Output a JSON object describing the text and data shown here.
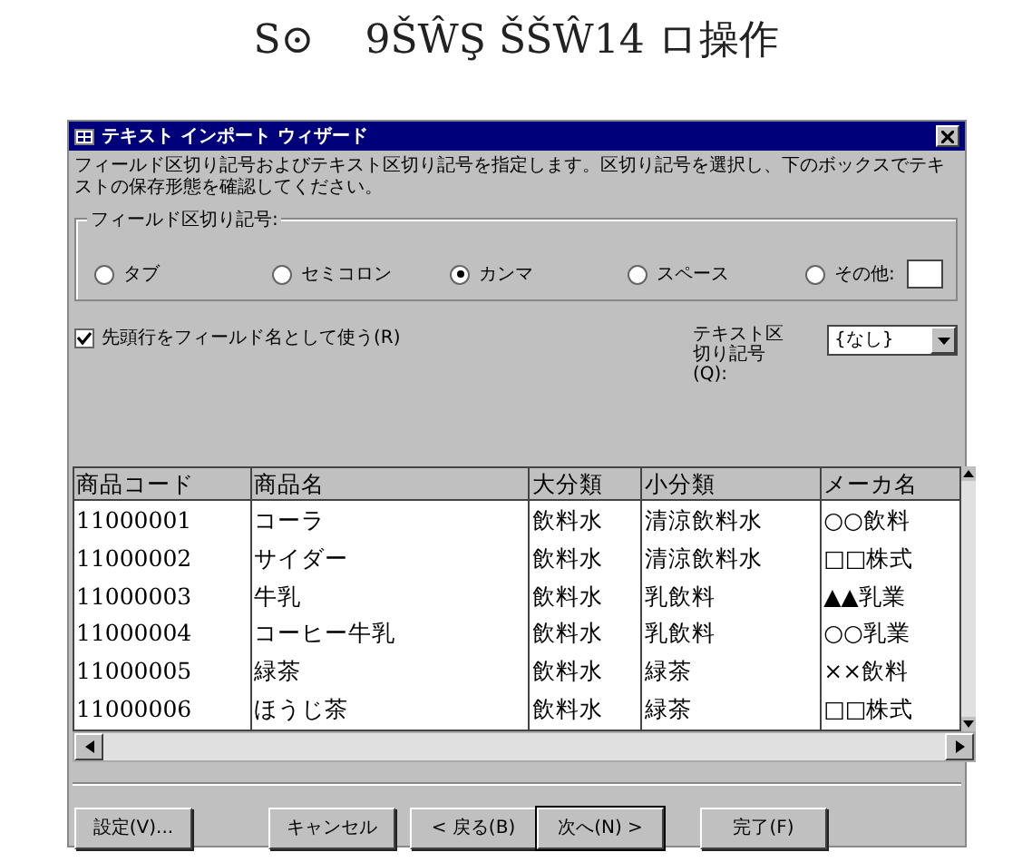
{
  "heading": {
    "number": "S⊙",
    "text": "9ŠŴŞ ŠŠŴ14 ロ操作"
  },
  "window": {
    "title": "テキスト インポート ウィザード"
  },
  "description": "フィールド区切り記号およびテキスト区切り記号を指定します。区切り記号を選択し、下のボックスでテキストの保存形態を確認してください。",
  "field_delimiter": {
    "label": "フィールド区切り記号:",
    "options": [
      {
        "label": "タブ",
        "selected": false
      },
      {
        "label": "セミコロン",
        "selected": false
      },
      {
        "label": "カンマ",
        "selected": true
      },
      {
        "label": "スペース",
        "selected": false
      },
      {
        "label": "その他:",
        "selected": false
      }
    ]
  },
  "first_row_names": {
    "label": "先頭行をフィールド名として使う(R)",
    "checked": true
  },
  "text_qualifier": {
    "label": "テキスト区切り記号(Q):",
    "value": "{なし}"
  },
  "table": {
    "columns": [
      "商品コード",
      "商品名",
      "大分類",
      "小分類",
      "メーカ名"
    ],
    "rows": [
      [
        "11000001",
        "コーラ",
        "飲料水",
        "清涼飲料水",
        "○○飲料"
      ],
      [
        "11000002",
        "サイダー",
        "飲料水",
        "清涼飲料水",
        "□□株式"
      ],
      [
        "11000003",
        "牛乳",
        "飲料水",
        "乳飲料",
        "▲▲乳業"
      ],
      [
        "11000004",
        "コーヒー牛乳",
        "飲料水",
        "乳飲料",
        "○○乳業"
      ],
      [
        "11000005",
        "緑茶",
        "飲料水",
        "緑茶",
        "××飲料"
      ],
      [
        "11000006",
        "ほうじ茶",
        "飲料水",
        "緑茶",
        "□□株式"
      ]
    ]
  },
  "buttons": [
    {
      "label": "設定(V)...",
      "default": false
    },
    {
      "label": "キャンセル",
      "default": false
    },
    {
      "label": "< 戻る(B)",
      "default": false
    },
    {
      "label": "次へ(N) >",
      "default": true
    },
    {
      "label": "完了(F)",
      "default": false
    }
  ]
}
